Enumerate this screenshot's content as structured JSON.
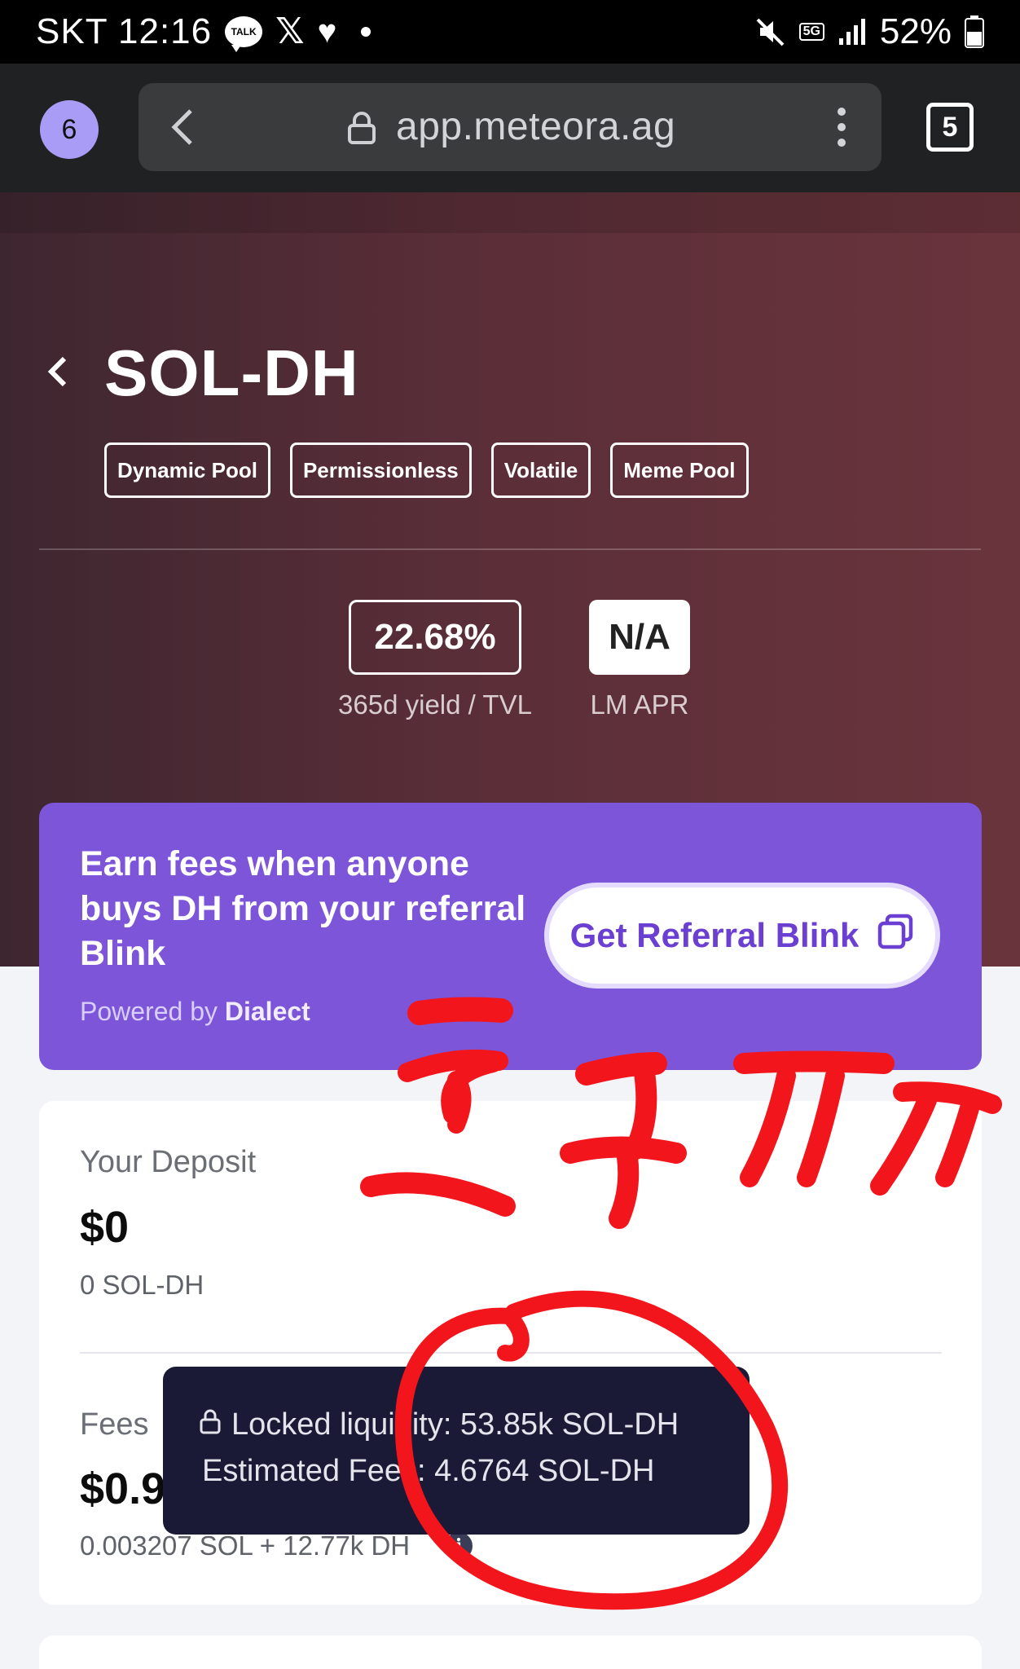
{
  "status_bar": {
    "carrier": "SKT",
    "time": "12:16",
    "talk_label": "TALK",
    "network": "5G",
    "battery": "52%"
  },
  "browser": {
    "profile_number": "6",
    "url": "app.meteora.ag",
    "tab_count": "5"
  },
  "pool": {
    "title": "SOL-DH",
    "tags": [
      "Dynamic Pool",
      "Permissionless",
      "Volatile",
      "Meme Pool"
    ],
    "yield_value": "22.68%",
    "yield_label": "365d yield / TVL",
    "lm_apr_value": "N/A",
    "lm_apr_label": "LM APR"
  },
  "referral": {
    "text": "Earn fees when anyone buys DH from your referral Blink",
    "powered_prefix": "Powered by",
    "powered_brand": "Dialect",
    "button_label": "Get Referral Blink"
  },
  "deposit": {
    "label": "Your Deposit",
    "value": "$0",
    "sub": "0 SOL-DH",
    "fees_label": "Fees",
    "fees_value": "$0.9",
    "fees_sub": "0.003207 SOL + 12.77k DH"
  },
  "tooltip": {
    "line1": "Locked liquidity: 53.85k SOL-DH",
    "line2": "Estimated Fees: 4.6764 SOL-DH"
  },
  "colors": {
    "accent_purple": "#7c55d8",
    "annotation_red": "#f2161c",
    "tooltip_bg": "#1b1a36"
  }
}
